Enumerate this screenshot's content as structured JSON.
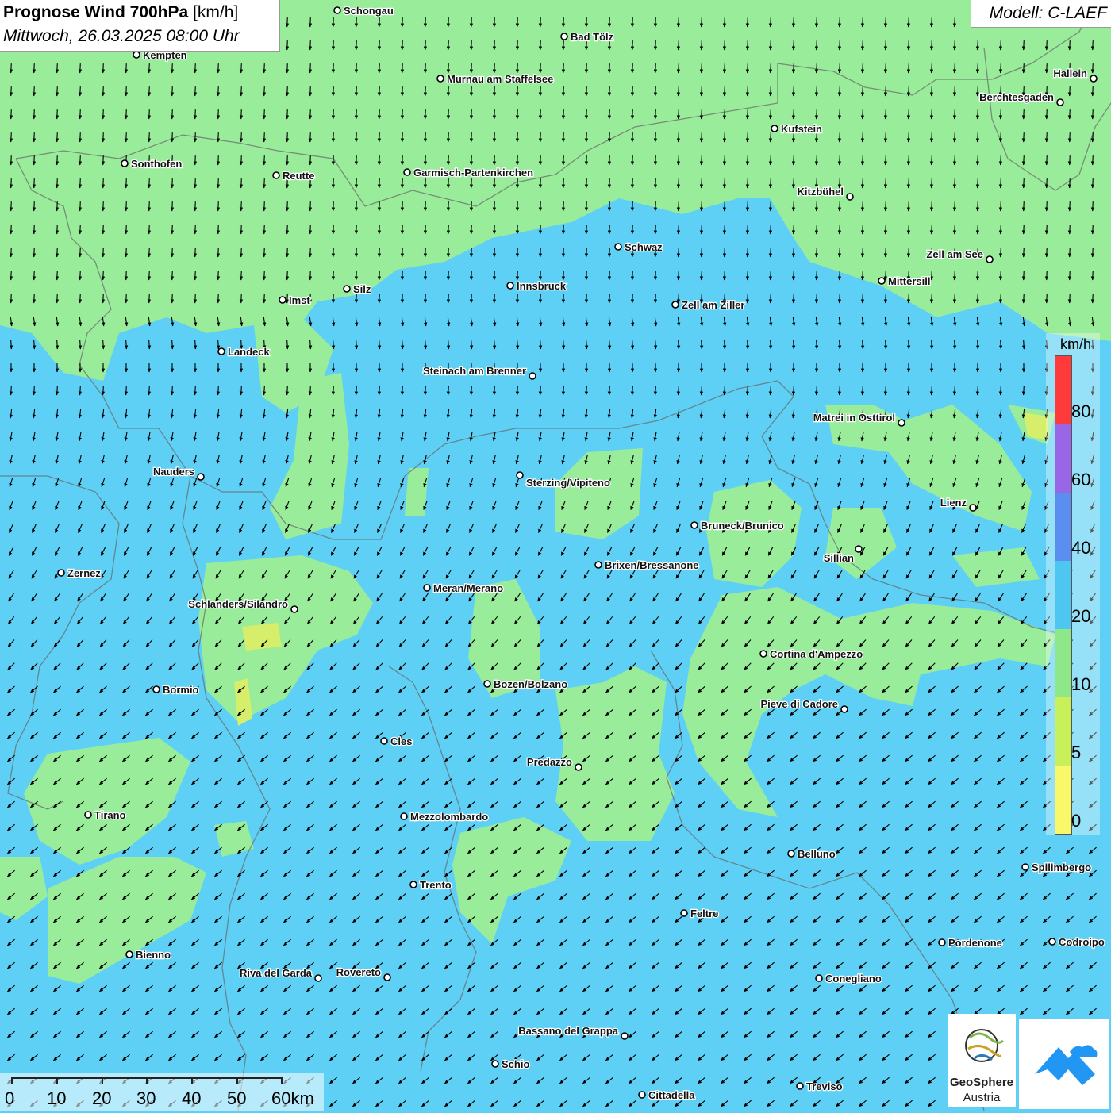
{
  "header": {
    "title": "Prognose Wind 700hPa",
    "unit": "[km/h]",
    "datetime": "Mittwoch, 26.03.2025 08:00 Uhr",
    "model": "Modell: C-LAEF"
  },
  "legend": {
    "unit": "km/h",
    "levels": [
      "80",
      "60",
      "40",
      "20",
      "10",
      "5",
      "0"
    ],
    "colors": [
      "#ff3a3a",
      "#9966e6",
      "#5a8ff0",
      "#4ec6f2",
      "#8ee88a",
      "#c8f05a",
      "#f8f86a"
    ]
  },
  "scale_bar": {
    "labels": [
      "0",
      "10",
      "20",
      "30",
      "40",
      "50",
      "60km"
    ]
  },
  "logos": {
    "geosphere_line1": "GeoSphere",
    "geosphere_line2": "Austria",
    "geosphere_icon": "geosphere-logo-icon",
    "second_icon": "mountain-cloud-logo-icon"
  },
  "wind": {
    "direction_north": "north-northwest flow",
    "direction_south": "northeast flow"
  },
  "colors": {
    "calm_green": "#99ec9a",
    "moderate_blue": "#5fd0f5",
    "light_yellow": "#d6ee6a"
  },
  "cities": [
    {
      "name": "Schongau"
    },
    {
      "name": "Bad Tölz"
    },
    {
      "name": "Kempten"
    },
    {
      "name": "Murnau am Staffelsee"
    },
    {
      "name": "Hallein"
    },
    {
      "name": "Berchtesgaden"
    },
    {
      "name": "Kufstein"
    },
    {
      "name": "Sonthofen"
    },
    {
      "name": "Reutte"
    },
    {
      "name": "Garmisch-Partenkirchen"
    },
    {
      "name": "Kitzbühel"
    },
    {
      "name": "Schwaz"
    },
    {
      "name": "Zell am See"
    },
    {
      "name": "Mittersill"
    },
    {
      "name": "Silz"
    },
    {
      "name": "Innsbruck"
    },
    {
      "name": "Imst"
    },
    {
      "name": "Zell am Ziller"
    },
    {
      "name": "Landeck"
    },
    {
      "name": "Steinach am Brenner"
    },
    {
      "name": "Matrei in Osttirol"
    },
    {
      "name": "Nauders"
    },
    {
      "name": "Sterzing/Vipiteno"
    },
    {
      "name": "Lienz"
    },
    {
      "name": "Bruneck/Brunico"
    },
    {
      "name": "Sillian"
    },
    {
      "name": "Brixen/Bressanone"
    },
    {
      "name": "Zernez"
    },
    {
      "name": "Meran/Merano"
    },
    {
      "name": "Schlanders/Silandro"
    },
    {
      "name": "Cortina d'Ampezzo"
    },
    {
      "name": "Bozen/Bolzano"
    },
    {
      "name": "Bormio"
    },
    {
      "name": "Pieve di Cadore"
    },
    {
      "name": "Cles"
    },
    {
      "name": "Predazzo"
    },
    {
      "name": "Tirano"
    },
    {
      "name": "Mezzolombardo"
    },
    {
      "name": "Belluno"
    },
    {
      "name": "Spilimbergo"
    },
    {
      "name": "Trento"
    },
    {
      "name": "Feltre"
    },
    {
      "name": "Pordenone"
    },
    {
      "name": "Codroipo"
    },
    {
      "name": "Bienno"
    },
    {
      "name": "Riva del Garda"
    },
    {
      "name": "Rovereto"
    },
    {
      "name": "Conegliano"
    },
    {
      "name": "Bassano del Grappa"
    },
    {
      "name": "Schio"
    },
    {
      "name": "Treviso"
    },
    {
      "name": "Cittadella"
    }
  ]
}
